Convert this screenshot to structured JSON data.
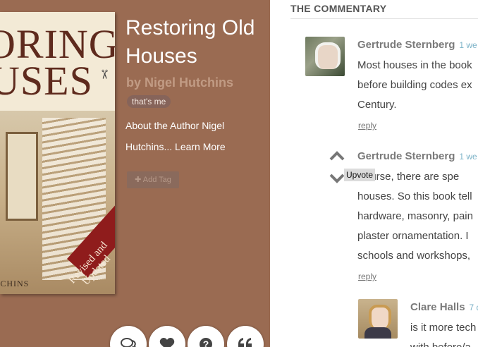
{
  "book": {
    "cover": {
      "title_line1": "ORING",
      "title_line2": "USES",
      "badge_line1": "Revised and",
      "badge_line2": "Updated",
      "author_text": "TCHINS"
    },
    "title": "Restoring Old Houses",
    "author": "by Nigel Hutchins",
    "thats_me": "that's me",
    "about_text": "About the Author Nigel Hutchins...",
    "learn_more": "Learn More",
    "add_tag": "Add Tag",
    "add_tag_icon": "plus-icon"
  },
  "actions": [
    {
      "name": "comments-button",
      "icon": "speech-bubbles-icon"
    },
    {
      "name": "like-button",
      "icon": "heart-icon"
    },
    {
      "name": "question-button",
      "icon": "question-icon"
    },
    {
      "name": "quote-button",
      "icon": "quote-icon"
    }
  ],
  "commentary": {
    "heading": "THE COMMENTARY",
    "comments": [
      {
        "author": "Gertrude Sternberg",
        "time": "1 we",
        "lines": [
          "Most houses in the book",
          "before building codes ex",
          "Century."
        ],
        "reply": "reply"
      },
      {
        "author": "Gertrude Sternberg",
        "time": "1 we",
        "lines": [
          "ourse, there are spe",
          "houses. So this book tell",
          "hardware, masonry, pain",
          "plaster ornamentation. I",
          "schools and workshops,"
        ],
        "reply": "reply",
        "tooltip": "Upvote"
      },
      {
        "author": "Clare Halls",
        "time": "7 d",
        "lines": [
          "is it more tech",
          "with before/a"
        ]
      }
    ]
  },
  "colors": {
    "left_bg": "#9a6b52",
    "author_link": "#c19b84",
    "timestamp": "#7db3c8"
  }
}
